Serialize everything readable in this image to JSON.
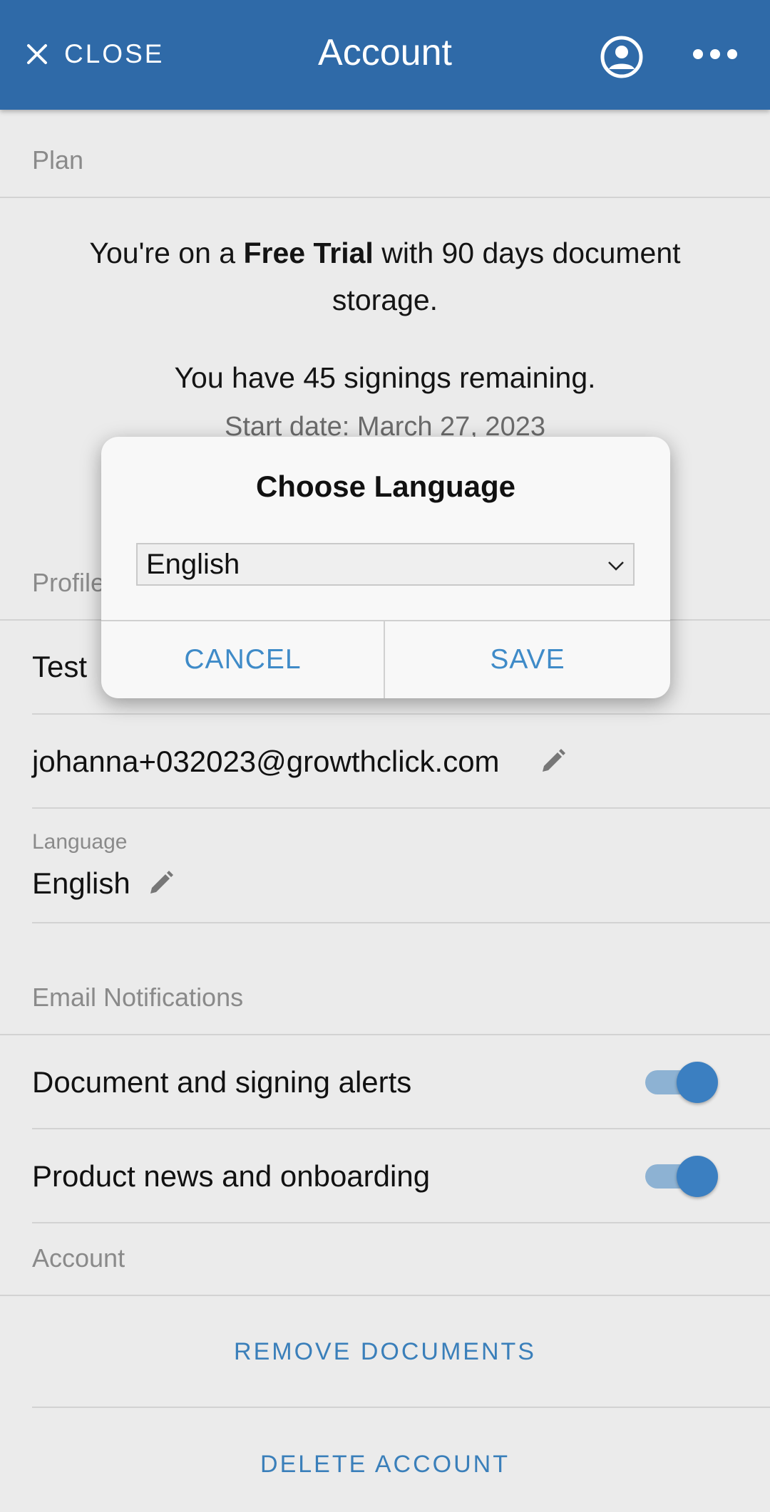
{
  "header": {
    "close_label": "CLOSE",
    "title": "Account",
    "close_icon": "close-icon",
    "account_icon": "account-circle-icon",
    "more_icon": "more-horizontal-icon"
  },
  "plan": {
    "section_label": "Plan",
    "line1_prefix": "You're on a ",
    "line1_bold": "Free Trial",
    "line1_suffix": " with 90 days document storage.",
    "signings": "You have 45 signings remaining.",
    "start_date": "Start date: March 27, 2023"
  },
  "profile": {
    "section_label": "Profile",
    "name": "Test",
    "email": "johanna+032023@growthclick.com",
    "language_label": "Language",
    "language_value": "English"
  },
  "notifications": {
    "section_label": "Email Notifications",
    "items": [
      {
        "label": "Document and signing alerts",
        "enabled": true
      },
      {
        "label": "Product news and onboarding",
        "enabled": true
      }
    ]
  },
  "account": {
    "section_label": "Account",
    "remove_documents": "REMOVE DOCUMENTS",
    "delete_account": "DELETE ACCOUNT"
  },
  "dialog": {
    "title": "Choose Language",
    "selected_language": "English",
    "cancel_label": "CANCEL",
    "save_label": "SAVE"
  },
  "colors": {
    "header_bg": "#2f6aa8",
    "accent": "#3a7fba",
    "background": "#ebebeb"
  }
}
